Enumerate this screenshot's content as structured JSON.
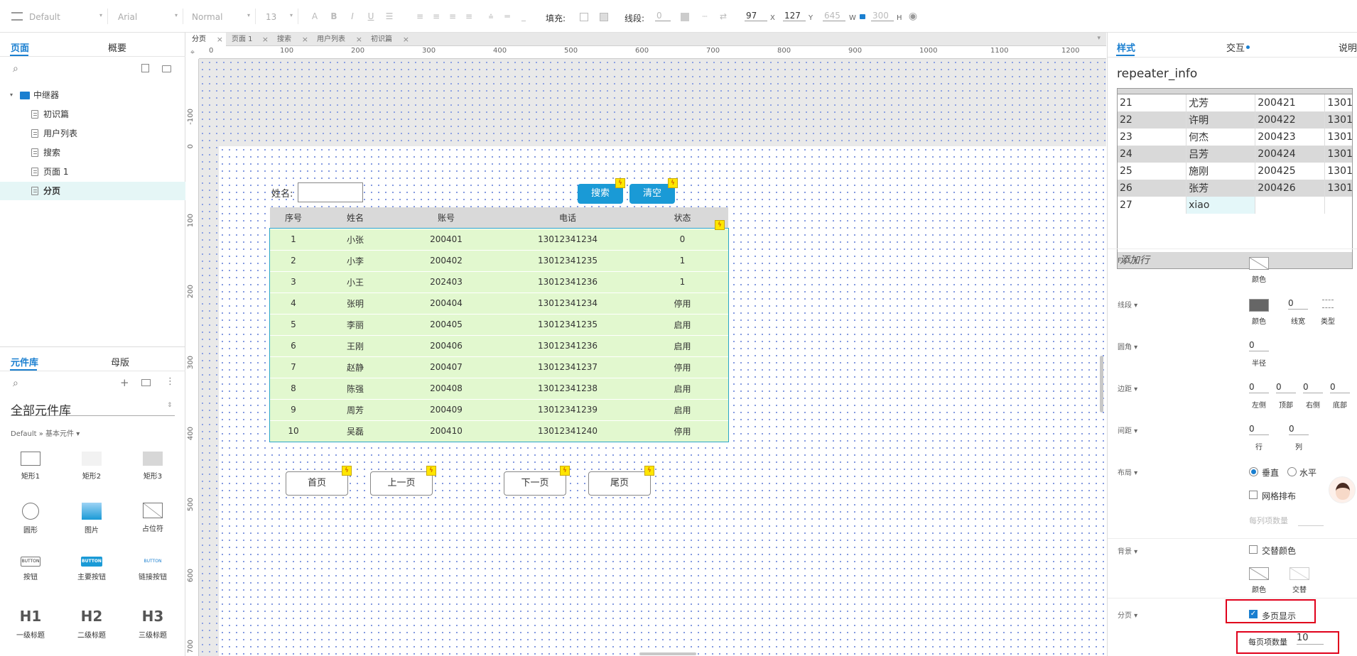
{
  "toolbar": {
    "style_select": "Default",
    "font_select": "Arial",
    "weight_select": "Normal",
    "size_select": "13",
    "fill_label": "填充:",
    "stroke_label": "线段:",
    "stroke_value": "0",
    "x_value": "97",
    "x_label": "X",
    "y_value": "127",
    "y_label": "Y",
    "w_value": "645",
    "w_label": "W",
    "h_value": "300",
    "h_label": "H"
  },
  "left": {
    "tabs": [
      "页面",
      "概要"
    ],
    "pages": [
      "中继器",
      "初识篇",
      "用户列表",
      "搜索",
      "页面 1",
      "分页"
    ],
    "lib_tabs": [
      "元件库",
      "母版"
    ],
    "lib_title": "全部元件库",
    "lib_breadcrumb": "Default » 基本元件 ▾",
    "widgets": [
      "矩形1",
      "矩形2",
      "矩形3",
      "圆形",
      "图片",
      "占位符",
      "按钮",
      "主要按钮",
      "链接按钮",
      "一级标题",
      "二级标题",
      "三级标题"
    ],
    "btn_glyph": "BUTTON",
    "headings": [
      "H1",
      "H2",
      "H3"
    ]
  },
  "canvas": {
    "doc_tabs": [
      "分页",
      "页面 1",
      "搜索",
      "用户列表",
      "初识篇"
    ],
    "ruler_h": [
      "0",
      "100",
      "200",
      "300",
      "400",
      "500",
      "600",
      "700",
      "800",
      "900",
      "1000",
      "1100",
      "1200"
    ],
    "ruler_v": [
      "-100",
      "0",
      "100",
      "200",
      "300",
      "400",
      "500",
      "600",
      "700"
    ],
    "name_label": "姓名:",
    "search_btn": "搜索",
    "clear_btn": "清空",
    "table_headers": [
      "序号",
      "姓名",
      "账号",
      "电话",
      "状态"
    ],
    "rows": [
      [
        "1",
        "小张",
        "200401",
        "13012341234",
        "0"
      ],
      [
        "2",
        "小李",
        "200402",
        "13012341235",
        "1"
      ],
      [
        "3",
        "小王",
        "202403",
        "13012341236",
        "1"
      ],
      [
        "4",
        "张明",
        "200404",
        "13012341234",
        "停用"
      ],
      [
        "5",
        "李丽",
        "200405",
        "13012341235",
        "启用"
      ],
      [
        "6",
        "王刚",
        "200406",
        "13012341236",
        "启用"
      ],
      [
        "7",
        "赵静",
        "200407",
        "13012341237",
        "停用"
      ],
      [
        "8",
        "陈强",
        "200408",
        "13012341238",
        "启用"
      ],
      [
        "9",
        "周芳",
        "200409",
        "13012341239",
        "启用"
      ],
      [
        "10",
        "吴磊",
        "200410",
        "13012341240",
        "停用"
      ]
    ],
    "pager": [
      "首页",
      "上一页",
      "下一页",
      "尾页"
    ]
  },
  "right": {
    "tabs": [
      "样式",
      "交互",
      "说明"
    ],
    "title": "repeater_info",
    "data_rows": [
      [
        "21",
        "尤芳",
        "200421",
        "1301"
      ],
      [
        "22",
        "许明",
        "200422",
        "1301"
      ],
      [
        "23",
        "何杰",
        "200423",
        "1301"
      ],
      [
        "24",
        "吕芳",
        "200424",
        "1301"
      ],
      [
        "25",
        "施刚",
        "200425",
        "1301"
      ],
      [
        "26",
        "张芳",
        "200426",
        "1301"
      ],
      [
        "27",
        "xiao",
        "",
        ""
      ]
    ],
    "add_row": "添加行",
    "fill": {
      "label": "FILL ▾",
      "color": "颜色"
    },
    "stroke": {
      "label": "线段 ▾",
      "color": "颜色",
      "width": "0",
      "width_label": "线宽",
      "type_label": "类型"
    },
    "radius": {
      "label": "圆角 ▾",
      "value": "0",
      "sub": "半径"
    },
    "padding": {
      "label": "边距 ▾",
      "values": [
        "0",
        "0",
        "0",
        "0"
      ],
      "subs": [
        "左侧",
        "顶部",
        "右侧",
        "底部"
      ]
    },
    "spacing": {
      "label": "间距 ▾",
      "values": [
        "0",
        "0"
      ],
      "subs": [
        "行",
        "列"
      ]
    },
    "layout": {
      "label": "布局 ▾",
      "vertical": "垂直",
      "horizontal": "水平",
      "grid": "网格排布",
      "per_col": "每列项数量"
    },
    "background": {
      "label": "背景 ▾",
      "alt": "交替颜色",
      "color": "颜色",
      "alt_color": "交替"
    },
    "paging": {
      "label": "分页 ▾",
      "multi": "多页显示",
      "per_page_label": "每页项数量",
      "per_page": "10"
    }
  }
}
